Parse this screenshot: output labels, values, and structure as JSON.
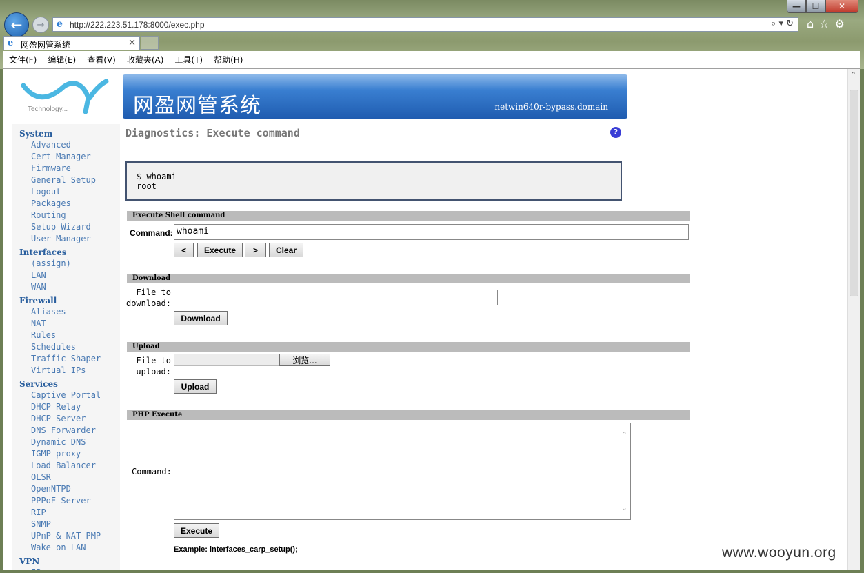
{
  "window": {
    "minimize": "—",
    "maximize": "☐",
    "close": "✕"
  },
  "browser": {
    "url": "http://222.223.51.178:8000/exec.php",
    "tab_title": "网盈网管系统",
    "address_tools": "⌕ ▾ ↻",
    "icons": [
      "home-icon",
      "star-icon",
      "gear-icon"
    ]
  },
  "menu": [
    "文件(F)",
    "编辑(E)",
    "查看(V)",
    "收藏夹(A)",
    "工具(T)",
    "帮助(H)"
  ],
  "logo": {
    "text": "Technology..."
  },
  "banner": {
    "title": "网盈网管系统",
    "hostname": "netwin640r-bypass.domain"
  },
  "sidebar": [
    {
      "section": "System",
      "items": [
        "Advanced",
        "Cert Manager",
        "Firmware",
        "General Setup",
        "Logout",
        "Packages",
        "Routing",
        "Setup Wizard",
        "User Manager"
      ]
    },
    {
      "section": "Interfaces",
      "items": [
        "(assign)",
        "LAN",
        "WAN"
      ]
    },
    {
      "section": "Firewall",
      "items": [
        "Aliases",
        "NAT",
        "Rules",
        "Schedules",
        "Traffic Shaper",
        "Virtual IPs"
      ]
    },
    {
      "section": "Services",
      "items": [
        "Captive Portal",
        "DHCP Relay",
        "DHCP Server",
        "DNS Forwarder",
        "Dynamic DNS",
        "IGMP proxy",
        "Load Balancer",
        "OLSR",
        "OpenNTPD",
        "PPPoE Server",
        "RIP",
        "SNMP",
        "UPnP & NAT-PMP",
        "Wake on LAN"
      ]
    },
    {
      "section": "VPN",
      "items": [
        "IPsec"
      ]
    }
  ],
  "page": {
    "heading": "Diagnostics: Execute command",
    "help": "?",
    "output_line1": "$ whoami",
    "output_line2": "root"
  },
  "shell": {
    "section_title": "Execute Shell command",
    "command_label": "Command:",
    "command_value": "whoami",
    "prev_label": "<",
    "execute_label": "Execute",
    "next_label": ">",
    "clear_label": "Clear"
  },
  "download": {
    "section_title": "Download",
    "label_line1": "File to",
    "label_line2": "download:",
    "value": "",
    "button_label": "Download"
  },
  "upload": {
    "section_title": "Upload",
    "label_line1": "File to",
    "label_line2": "upload:",
    "browse_label": "浏览...",
    "button_label": "Upload"
  },
  "php": {
    "section_title": "PHP Execute",
    "command_label": "Command:",
    "execute_label": "Execute",
    "example": "Example: interfaces_carp_setup();"
  },
  "watermark": "www.wooyun.org"
}
